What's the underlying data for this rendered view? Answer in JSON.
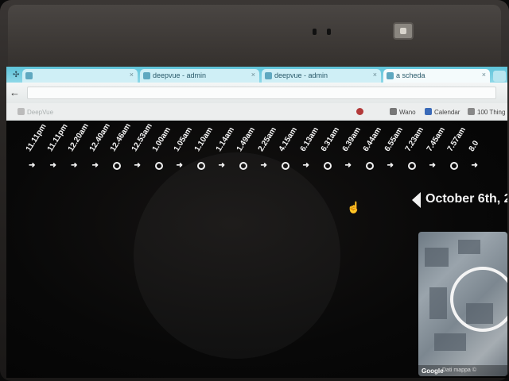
{
  "browser": {
    "tabs": [
      {
        "label": "",
        "active": false
      },
      {
        "label": "deepvue - admin",
        "active": false
      },
      {
        "label": "deepvue - admin",
        "active": false
      },
      {
        "label": "a scheda",
        "active": true
      }
    ],
    "omnibox_value": "",
    "bookmarks": [
      {
        "label": "DeepVue",
        "faint": true,
        "icon_color": "#bbbbbb"
      },
      {
        "label": "",
        "faint": false,
        "icon_color": "#b33a3a"
      },
      {
        "label": "Wano",
        "faint": false,
        "icon_color": "#777777"
      },
      {
        "label": "Calendar",
        "faint": false,
        "icon_color": "#3a6ab8"
      },
      {
        "label": "100 Thing",
        "faint": false,
        "icon_color": "#888888"
      }
    ]
  },
  "timeline": {
    "entries": [
      {
        "time": "11.11pm",
        "marker": "arrow"
      },
      {
        "time": "11.11pm",
        "marker": "arrow"
      },
      {
        "time": "12.20am",
        "marker": "arrow"
      },
      {
        "time": "12.40am",
        "marker": "arrow"
      },
      {
        "time": "12.46am",
        "marker": "circle"
      },
      {
        "time": "12.53am",
        "marker": "arrow"
      },
      {
        "time": "1.00am",
        "marker": "circle"
      },
      {
        "time": "1.05am",
        "marker": "arrow"
      },
      {
        "time": "1.10am",
        "marker": "circle"
      },
      {
        "time": "1.14am",
        "marker": "arrow"
      },
      {
        "time": "1.49am",
        "marker": "circle"
      },
      {
        "time": "2.25am",
        "marker": "arrow"
      },
      {
        "time": "4.15am",
        "marker": "circle"
      },
      {
        "time": "6.13am",
        "marker": "arrow"
      },
      {
        "time": "6.31am",
        "marker": "circle"
      },
      {
        "time": "6.39am",
        "marker": "arrow"
      },
      {
        "time": "6.44am",
        "marker": "circle"
      },
      {
        "time": "6.55am",
        "marker": "arrow"
      },
      {
        "time": "7.23am",
        "marker": "circle"
      },
      {
        "time": "7.45am",
        "marker": "arrow"
      },
      {
        "time": "7.57am",
        "marker": "circle"
      },
      {
        "time": "8.0",
        "marker": "arrow"
      }
    ],
    "date_label": "October 6th, 2"
  },
  "map": {
    "logo": "Google",
    "footer": "Dati mappa ©"
  }
}
